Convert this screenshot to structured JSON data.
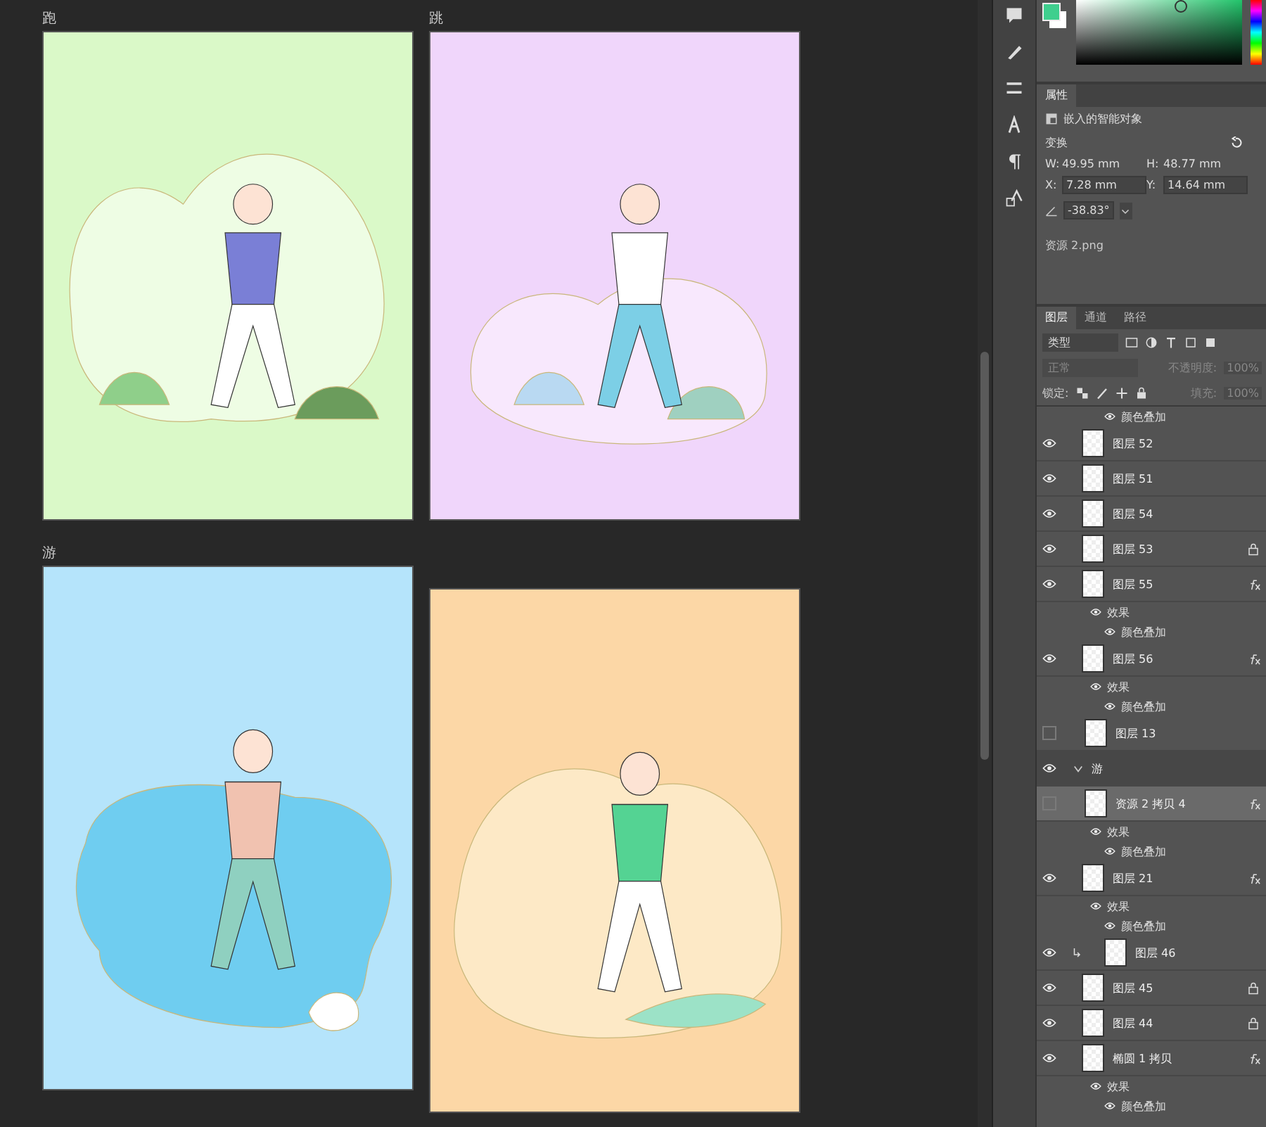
{
  "artboards": [
    {
      "label": "跑",
      "color": "#daf9c8"
    },
    {
      "label": "跳",
      "color": "#f0d6fb"
    },
    {
      "label": "游",
      "color": "#b5e4fb"
    },
    {
      "color": "#fcd7a6"
    }
  ],
  "properties": {
    "tabs": [
      {
        "label": "属性",
        "selected": true
      }
    ],
    "object_type": "嵌入的智能对象",
    "section": "变换",
    "w_label": "W:",
    "w": "49.95 mm",
    "h_label": "H:",
    "h": "48.77 mm",
    "x_label": "X:",
    "x": "7.28 mm",
    "y_label": "Y:",
    "y": "14.64 mm",
    "angle": "-38.83°",
    "file": "资源 2.png"
  },
  "layers_panel": {
    "tabs": [
      {
        "label": "图层",
        "selected": true
      },
      {
        "label": "通道",
        "selected": false
      },
      {
        "label": "路径",
        "selected": false
      }
    ],
    "filter": "类型",
    "blend_mode": "正常",
    "opacity_label": "不透明度:",
    "opacity": "100%",
    "lock_label": "锁定:",
    "fill_label": "填充:",
    "fill": "100%",
    "layers": [
      {
        "kind": "effect",
        "name": "颜色叠加"
      },
      {
        "kind": "layer",
        "name": "图层 52",
        "visible": true,
        "selected": false,
        "locked": false,
        "fx": false,
        "clipped": false
      },
      {
        "kind": "layer",
        "name": "图层 51",
        "visible": true,
        "selected": false,
        "locked": false,
        "fx": false,
        "clipped": false
      },
      {
        "kind": "layer",
        "name": "图层 54",
        "visible": true,
        "selected": false,
        "locked": false,
        "fx": false,
        "clipped": false
      },
      {
        "kind": "layer",
        "name": "图层 53",
        "visible": true,
        "selected": false,
        "locked": true,
        "fx": false,
        "clipped": false
      },
      {
        "kind": "layer",
        "name": "图层 55",
        "visible": true,
        "selected": false,
        "locked": false,
        "fx": true,
        "clipped": false
      },
      {
        "kind": "effects",
        "name": "效果"
      },
      {
        "kind": "effect",
        "name": "颜色叠加"
      },
      {
        "kind": "layer",
        "name": "图层 56",
        "visible": true,
        "selected": false,
        "locked": false,
        "fx": true,
        "clipped": false
      },
      {
        "kind": "effects",
        "name": "效果"
      },
      {
        "kind": "effect",
        "name": "颜色叠加"
      },
      {
        "kind": "layer",
        "name": "图层 13",
        "visible": false,
        "selected": false,
        "locked": false,
        "fx": false,
        "clipped": false
      },
      {
        "kind": "group",
        "name": "游",
        "visible": true,
        "expanded": true
      },
      {
        "kind": "layer",
        "name": "资源 2 拷贝 4",
        "visible": false,
        "selected": true,
        "locked": false,
        "fx": true,
        "clipped": false
      },
      {
        "kind": "effects",
        "name": "效果"
      },
      {
        "kind": "effect",
        "name": "颜色叠加"
      },
      {
        "kind": "layer",
        "name": "图层 21",
        "visible": true,
        "selected": false,
        "locked": false,
        "fx": true,
        "clipped": false
      },
      {
        "kind": "effects",
        "name": "效果"
      },
      {
        "kind": "effect",
        "name": "颜色叠加"
      },
      {
        "kind": "layer",
        "name": "图层 46",
        "visible": true,
        "selected": false,
        "locked": false,
        "fx": false,
        "clipped": true
      },
      {
        "kind": "layer",
        "name": "图层 45",
        "visible": true,
        "selected": false,
        "locked": true,
        "fx": false,
        "clipped": false
      },
      {
        "kind": "layer",
        "name": "图层 44",
        "visible": true,
        "selected": false,
        "locked": true,
        "fx": false,
        "clipped": false
      },
      {
        "kind": "layer",
        "name": "椭圆 1 拷贝",
        "visible": true,
        "selected": false,
        "locked": false,
        "fx": true,
        "clipped": false
      },
      {
        "kind": "effects",
        "name": "效果"
      },
      {
        "kind": "effect",
        "name": "颜色叠加"
      }
    ]
  }
}
